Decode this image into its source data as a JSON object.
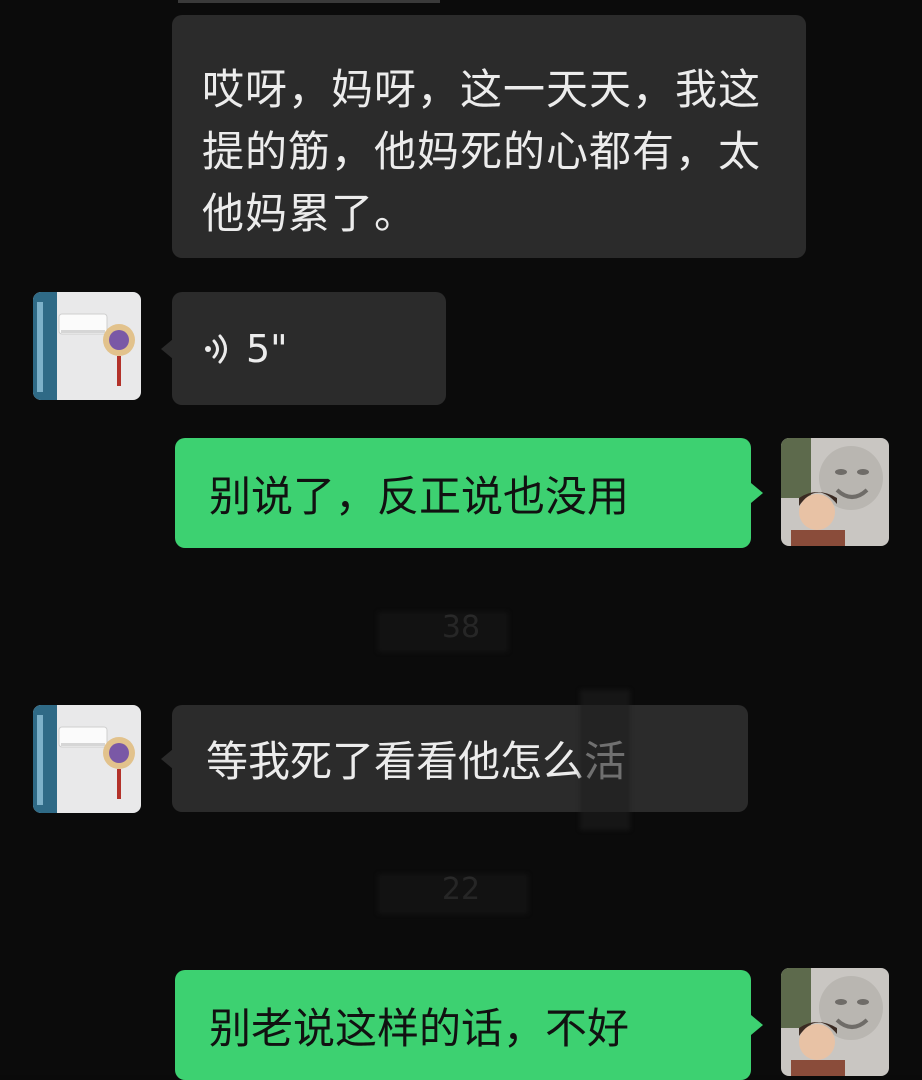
{
  "messages": [
    {
      "sender": "other",
      "type": "text",
      "text": "哎呀，妈呀，这一天天，我这提的筋，他妈死的心都有，太他妈累了。"
    },
    {
      "sender": "other",
      "type": "voice",
      "duration": "5\""
    },
    {
      "sender": "me",
      "type": "text",
      "text": "别说了，反正说也没用"
    },
    {
      "sender": "other",
      "type": "text",
      "text": "等我死了看看他怎么活"
    },
    {
      "sender": "me",
      "type": "text",
      "text": "别老说这样的话，不好"
    }
  ],
  "timestamps": [
    "38",
    "22"
  ],
  "icons": {
    "voice": "voice-wave-icon",
    "avatar_other": "avatar-room-photo",
    "avatar_me": "avatar-statue-photo"
  },
  "colors": {
    "background": "#0b0b0b",
    "incoming_bubble": "#2b2b2b",
    "outgoing_bubble": "#3dd171"
  }
}
